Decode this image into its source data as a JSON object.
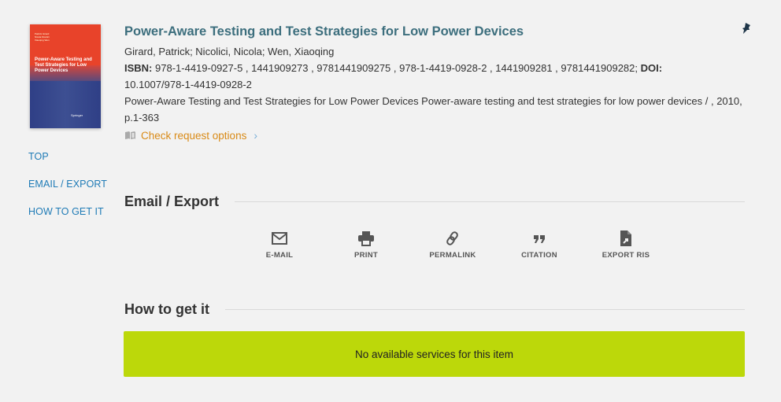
{
  "record": {
    "title": "Power-Aware Testing and Test Strategies for Low Power Devices",
    "authors": "Girard, Patrick; Nicolici, Nicola; Wen, Xiaoqing",
    "isbn_label": "ISBN:",
    "isbn_values": "978-1-4419-0927-5 , 1441909273 , 9781441909275 , 978-1-4419-0928-2 , 1441909281 , 9781441909282;",
    "doi_label": "DOI:",
    "doi_value": "10.1007/978-1-4419-0928-2",
    "description": "Power-Aware Testing and Test Strategies for Low Power Devices Power-aware testing and test strategies for low power devices / , 2010, p.1-363",
    "check_request": "Check request options",
    "cover": {
      "authors": [
        "Patrick Girard",
        "Nicola Nicolici",
        "Xiaoqing Wen"
      ],
      "title": "Power-Aware Testing and Test Strategies for Low Power Devices",
      "publisher": "Springer"
    }
  },
  "nav": {
    "items": [
      {
        "label": "TOP"
      },
      {
        "label": "EMAIL / EXPORT"
      },
      {
        "label": "HOW TO GET IT"
      }
    ]
  },
  "email_export": {
    "heading": "Email / Export",
    "actions": [
      {
        "label": "E-MAIL",
        "icon": "envelope-icon"
      },
      {
        "label": "PRINT",
        "icon": "printer-icon"
      },
      {
        "label": "PERMALINK",
        "icon": "link-icon"
      },
      {
        "label": "CITATION",
        "icon": "quote-icon"
      },
      {
        "label": "EXPORT RIS",
        "icon": "file-export-icon"
      }
    ]
  },
  "how_to_get": {
    "heading": "How to get it",
    "message": "No available services for this item"
  },
  "colors": {
    "title": "#3c6e7d",
    "link": "#1f7bb6",
    "request": "#d98a16",
    "availability_box": "#bcd80a",
    "background": "#f2f2f2"
  }
}
